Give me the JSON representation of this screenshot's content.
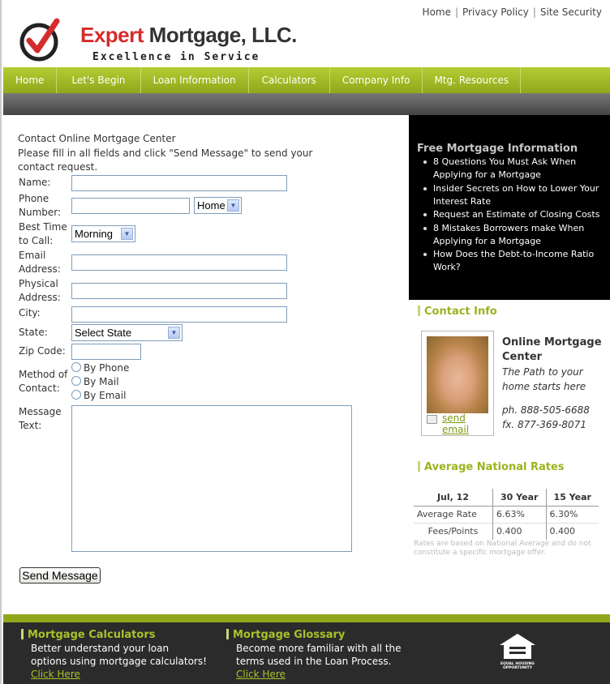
{
  "header": {
    "top_links": [
      "Home",
      "Privacy Policy",
      "Site Security"
    ],
    "brand_red": "Expert",
    "brand_dark": "Mortgage, LLC.",
    "tagline": "Excellence in Service"
  },
  "nav": [
    "Home",
    "Let's Begin",
    "Loan Information",
    "Calculators",
    "Company Info",
    "Mtg. Resources"
  ],
  "form": {
    "title": "Contact Online Mortgage Center",
    "instructions": "Please fill in all fields and click \"Send Message\" to send your contact request.",
    "labels": {
      "name": "Name:",
      "phone": "Phone Number:",
      "best_time": "Best Time to Call:",
      "email": "Email Address:",
      "physical": "Physical Address:",
      "city": "City:",
      "state": "State:",
      "zip": "Zip Code:",
      "method": "Method of Contact:",
      "message": "Message Text:"
    },
    "phone_type": "Home",
    "best_time_value": "Morning",
    "state_value": "Select State",
    "methods": [
      "By Phone",
      "By Mail",
      "By Email"
    ],
    "send_button": "Send Message"
  },
  "sidebar": {
    "free_info_title": "Free Mortgage Information",
    "free_info_items": [
      "8 Questions You Must Ask When Applying for a Mortgage",
      "Insider Secrets on How to Lower Your Interest Rate",
      "Request an Estimate of Closing Costs",
      "8 Mistakes Borrowers make When Applying for a Mortgage",
      "How Does the Debt-to-Income Ratio Work?"
    ],
    "contact_title": "Contact Info",
    "send_email": "send email",
    "company": "Online Mortgage Center",
    "slogan": "The Path to your home starts here",
    "phone": "ph. 888-505-6688",
    "fax": "fx. 877-369-8071",
    "rates_title": "Average National Rates",
    "rates": {
      "date": "Jul, 12",
      "col1": "30 Year",
      "col2": "15 Year",
      "rows": [
        {
          "label": "Average Rate",
          "v1": "6.63%",
          "v2": "6.30%"
        },
        {
          "label": "Fees/Points",
          "v1": "0.400",
          "v2": "0.400"
        }
      ]
    },
    "disclaimer": "Rates are based on National Average and do not constitute a specific mortgage offer."
  },
  "footer": {
    "calc_title": "Mortgage Calculators",
    "calc_text": "Better understand your loan options using mortgage calculators!",
    "calc_link": "Click Here",
    "glossary_title": "Mortgage Glossary",
    "glossary_text": "Become more familiar with all the terms used in the Loan Process.",
    "glossary_link": "Click Here",
    "eho_line1": "EQUAL HOUSING",
    "eho_line2": "OPPORTUNITY"
  },
  "colors": {
    "accent": "#9bb31e",
    "brand_red": "#d42c2c",
    "sidebar_bg": "#000000",
    "footer_bg": "#2b2b2b"
  }
}
